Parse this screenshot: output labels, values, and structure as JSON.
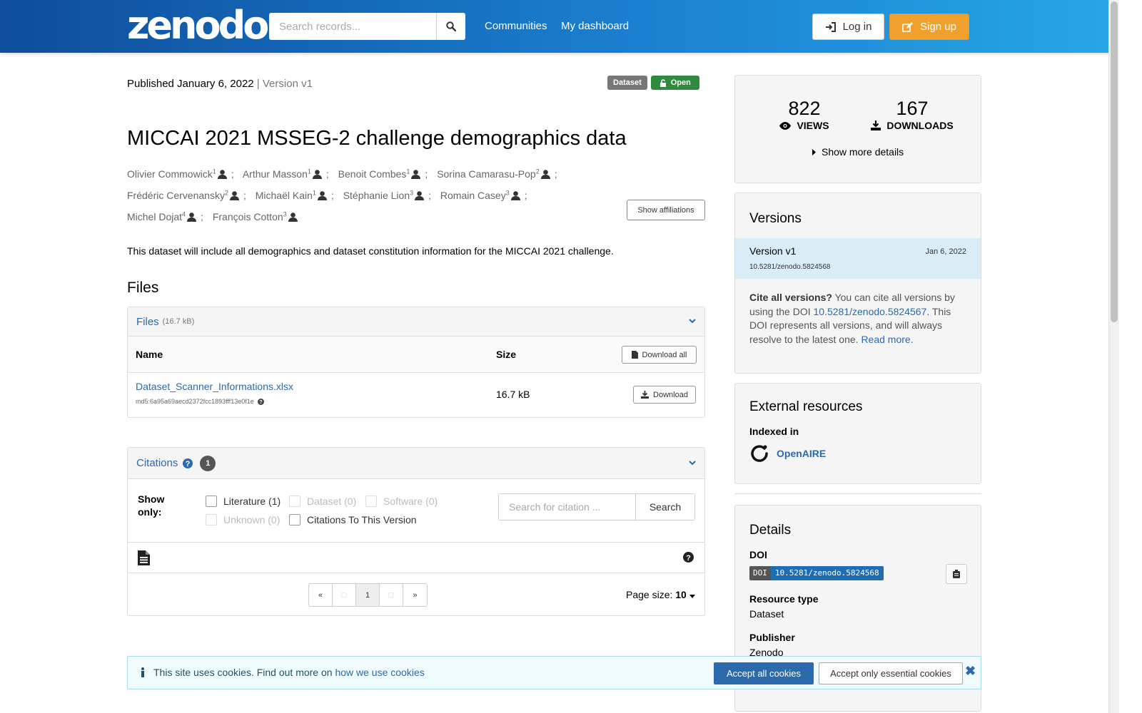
{
  "header": {
    "logo": "zenodo",
    "search_placeholder": "Search records...",
    "nav": [
      "Communities",
      "My dashboard"
    ],
    "login_label": "Log in",
    "signup_label": "Sign up"
  },
  "record": {
    "published": "Published January 6, 2022",
    "version_sep": " | ",
    "version": "Version v1",
    "badge_type": "Dataset",
    "badge_access": "Open",
    "title": "MICCAI 2021 MSSEG-2 challenge demographics data",
    "authors": [
      {
        "name": "Olivier Commowick",
        "aff": "1"
      },
      {
        "name": "Arthur Masson",
        "aff": "1"
      },
      {
        "name": "Benoit Combes",
        "aff": "1"
      },
      {
        "name": "Sorina Camarasu-Pop",
        "aff": "2"
      },
      {
        "name": "Frédéric Cervenansky",
        "aff": "2"
      },
      {
        "name": "Michaël Kain",
        "aff": "1"
      },
      {
        "name": "Stéphanie Lion",
        "aff": "3"
      },
      {
        "name": "Romain Casey",
        "aff": "3"
      },
      {
        "name": "Michel Dojat",
        "aff": "4"
      },
      {
        "name": "François Cotton",
        "aff": "3"
      }
    ],
    "show_affiliations_label": "Show affiliations",
    "description": "This dataset will include all demographics and dataset constitution information for the MICCAI 2021 challenge."
  },
  "files": {
    "heading": "Files",
    "panel_title": "Files",
    "panel_size": "(16.7 kB)",
    "col_name": "Name",
    "col_size": "Size",
    "download_all_label": "Download all",
    "rows": [
      {
        "name": "Dataset_Scanner_Informations.xlsx",
        "md5": "md5:6a95a69aecd2372fcc1893fff13e0f1e",
        "size": "16.7 kB",
        "download_label": "Download"
      }
    ]
  },
  "citations": {
    "title": "Citations",
    "count": "1",
    "show_only": "Show only:",
    "filters": [
      {
        "label": "Literature (1)",
        "enabled": true
      },
      {
        "label": "Dataset (0)",
        "enabled": false
      },
      {
        "label": "Software (0)",
        "enabled": false
      },
      {
        "label": "Unknown (0)",
        "enabled": false
      },
      {
        "label": "Citations To This Version",
        "enabled": true
      }
    ],
    "search_placeholder": "Search for citation ...",
    "search_button": "Search",
    "pager": [
      "«",
      "",
      "1",
      "",
      "»"
    ],
    "page_size_label": "Page size:",
    "page_size_value": "10"
  },
  "stats": {
    "views": "822",
    "views_label": "VIEWS",
    "downloads": "167",
    "downloads_label": "DOWNLOADS",
    "show_more": "Show more details"
  },
  "versions": {
    "heading": "Versions",
    "current_name": "Version v1",
    "current_date": "Jan 6, 2022",
    "current_doi": "10.5281/zenodo.5824568",
    "cite_bold": "Cite all versions?",
    "cite_text": " You can cite all versions by using the DOI ",
    "cite_doi": "10.5281/zenodo.5824567",
    "cite_text2": ". This DOI represents all versions, and will always resolve to the latest one. ",
    "read_more": "Read more."
  },
  "external": {
    "heading": "External resources",
    "indexed_in": "Indexed in",
    "openaire": "OpenAIRE"
  },
  "details": {
    "heading": "Details",
    "doi_label": "DOI",
    "doi_key": "DOI",
    "doi_value": "10.5281/zenodo.5824568",
    "resource_type_label": "Resource type",
    "resource_type": "Dataset",
    "publisher_label": "Publisher",
    "publisher": "Zenodo"
  },
  "cookie": {
    "text": "This site uses cookies. Find out more on ",
    "link": "how we use cookies",
    "accept_all": "Accept all cookies",
    "accept_essential": "Accept only essential cookies",
    "close": "✖"
  },
  "colors": {
    "brand_blue": "#1a7fd0",
    "link": "#2a6aad",
    "signup": "#f0a02c",
    "open_badge": "#2e8b3e"
  }
}
